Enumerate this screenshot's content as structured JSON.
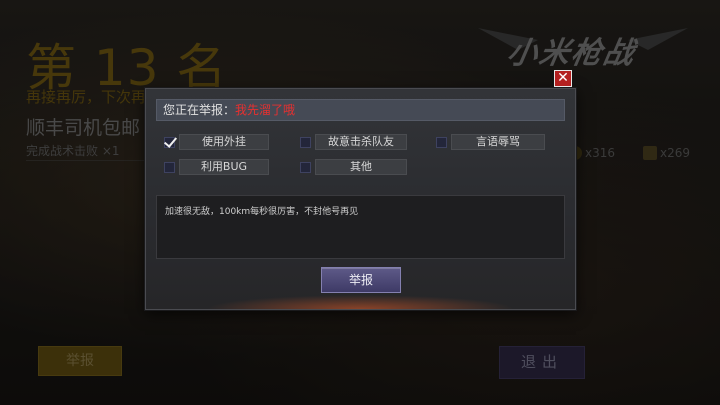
{
  "background": {
    "rank_text": "第 13 名",
    "subtitle_yellow": "再接再厉，下次再战！",
    "subtitle_player": "顺丰司机包邮",
    "kills_text": "完成战术击败 ×1",
    "logo_text": "小米枪战",
    "stat_coin": "x316",
    "stat_crate": "x269",
    "report_button": "举报",
    "exit_button": "退出"
  },
  "dialog": {
    "title_prefix": "您正在举报：",
    "reported_name": "我先溜了哦",
    "close_label": "✕",
    "options": [
      {
        "label": "使用外挂",
        "checked": true
      },
      {
        "label": "故意击杀队友",
        "checked": false
      },
      {
        "label": "言语辱骂",
        "checked": false
      },
      {
        "label": "利用BUG",
        "checked": false
      },
      {
        "label": "其他",
        "checked": false
      }
    ],
    "description": "加速很无敌，100km每秒很厉害，不封他号再见",
    "submit_label": "举报"
  },
  "colors": {
    "reported_name": "#e83030",
    "close_button": "#b42020",
    "submit_button": "#4a4678"
  }
}
